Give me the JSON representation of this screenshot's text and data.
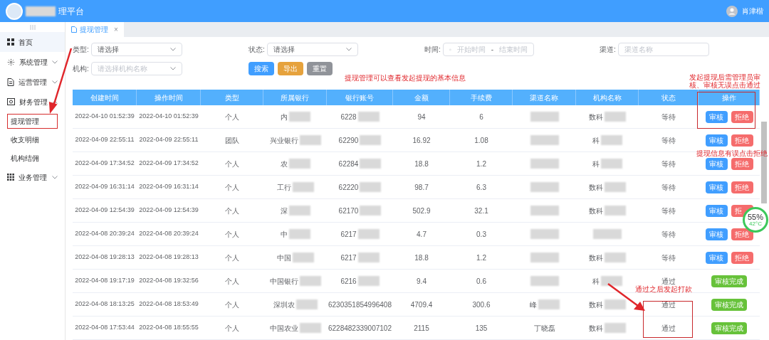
{
  "header": {
    "title": "理平台",
    "user": "肖津楷"
  },
  "sidebar": {
    "items": [
      {
        "label": "首页",
        "selected": true
      },
      {
        "label": "系统管理",
        "expanded": false
      },
      {
        "label": "运营管理",
        "expanded": false
      },
      {
        "label": "财务管理",
        "expanded": true,
        "children": [
          {
            "label": "提现管理",
            "selected": true
          },
          {
            "label": "收支明细",
            "selected": false
          },
          {
            "label": "机构结佣",
            "selected": false
          }
        ]
      },
      {
        "label": "业务管理",
        "expanded": false
      }
    ]
  },
  "tabs": [
    {
      "label": "提现管理",
      "selected": true,
      "close": "×"
    }
  ],
  "filters": [
    {
      "label": "类型:",
      "kind": "select",
      "value": "请选择"
    },
    {
      "label": "状态:",
      "kind": "select",
      "value": "请选择"
    },
    {
      "label": "时间:",
      "kind": "range",
      "start": "开始时间",
      "sep": "-",
      "end": "结束时间"
    },
    {
      "label": "渠道:",
      "kind": "text",
      "placeholder": "渠道名称"
    },
    {
      "label": "机构:",
      "kind": "select",
      "placeholder": "请选择机构名称"
    }
  ],
  "buttons": [
    {
      "label": "搜索",
      "kind": "primary"
    },
    {
      "label": "导出",
      "kind": "warning"
    },
    {
      "label": "重置",
      "kind": "neutral"
    }
  ],
  "table": {
    "columns": [
      "创建时间",
      "操作时间",
      "类型",
      "所属银行",
      "银行账号",
      "金额",
      "手续费",
      "渠道名称",
      "机构名称",
      "状态",
      "操作"
    ],
    "rows": [
      {
        "created": "2022-04-10 01:52:39",
        "updated": "2022-04-10 01:52:39",
        "type": "个人",
        "bank": {
          "text": "内",
          "redacted": true
        },
        "account": {
          "text": "6228",
          "redacted": true
        },
        "amount": "94",
        "fee": "6",
        "channel": {
          "redacted": true
        },
        "org": {
          "text": "数科",
          "redacted": true
        },
        "status": "等待",
        "actions": [
          {
            "label": "审核",
            "kind": "approve"
          },
          {
            "label": "拒绝",
            "kind": "reject"
          }
        ]
      },
      {
        "created": "2022-04-09 22:55:11",
        "updated": "2022-04-09 22:55:11",
        "type": "团队",
        "bank": {
          "text": "兴业银行",
          "redacted": true
        },
        "account": {
          "text": "62290",
          "redacted": true
        },
        "amount": "16.92",
        "fee": "1.08",
        "channel": {
          "redacted": true
        },
        "org": {
          "text": "科",
          "redacted": true
        },
        "status": "等待",
        "actions": [
          {
            "label": "审核",
            "kind": "approve"
          },
          {
            "label": "拒绝",
            "kind": "reject"
          }
        ]
      },
      {
        "created": "2022-04-09 17:34:52",
        "updated": "2022-04-09 17:34:52",
        "type": "个人",
        "bank": {
          "text": "农",
          "redacted": true
        },
        "account": {
          "text": "62284",
          "redacted": true
        },
        "amount": "18.8",
        "fee": "1.2",
        "channel": {
          "redacted": true
        },
        "org": {
          "text": "科",
          "redacted": true
        },
        "status": "等待",
        "actions": [
          {
            "label": "审核",
            "kind": "approve"
          },
          {
            "label": "拒绝",
            "kind": "reject"
          }
        ]
      },
      {
        "created": "2022-04-09 16:31:14",
        "updated": "2022-04-09 16:31:14",
        "type": "个人",
        "bank": {
          "text": "工行",
          "redacted": true
        },
        "account": {
          "text": "62220",
          "redacted": true
        },
        "amount": "98.7",
        "fee": "6.3",
        "channel": {
          "redacted": true
        },
        "org": {
          "text": "数科",
          "redacted": true
        },
        "status": "等待",
        "actions": [
          {
            "label": "审核",
            "kind": "approve"
          },
          {
            "label": "拒绝",
            "kind": "reject"
          }
        ]
      },
      {
        "created": "2022-04-09 12:54:39",
        "updated": "2022-04-09 12:54:39",
        "type": "个人",
        "bank": {
          "text": "深",
          "redacted": true
        },
        "account": {
          "text": "62170",
          "redacted": true
        },
        "amount": "502.9",
        "fee": "32.1",
        "channel": {
          "redacted": true
        },
        "org": {
          "text": "数科",
          "redacted": true
        },
        "status": "等待",
        "actions": [
          {
            "label": "审核",
            "kind": "approve"
          },
          {
            "label": "拒",
            "kind": "reject"
          }
        ]
      },
      {
        "created": "2022-04-08 20:39:24",
        "updated": "2022-04-08 20:39:24",
        "type": "个人",
        "bank": {
          "text": "中",
          "redacted": true
        },
        "account": {
          "text": "6217",
          "redacted": true
        },
        "amount": "4.7",
        "fee": "0.3",
        "channel": {
          "redacted": true
        },
        "org": {
          "redacted": true
        },
        "status": "等待",
        "actions": [
          {
            "label": "审核",
            "kind": "approve"
          },
          {
            "label": "拒绝",
            "kind": "reject"
          }
        ]
      },
      {
        "created": "2022-04-08 19:28:13",
        "updated": "2022-04-08 19:28:13",
        "type": "个人",
        "bank": {
          "text": "中国",
          "redacted": true
        },
        "account": {
          "text": "6217",
          "redacted": true
        },
        "amount": "18.8",
        "fee": "1.2",
        "channel": {
          "redacted": true
        },
        "org": {
          "text": "数科",
          "redacted": true
        },
        "status": "等待",
        "actions": [
          {
            "label": "审核",
            "kind": "approve"
          },
          {
            "label": "拒绝",
            "kind": "reject"
          }
        ]
      },
      {
        "created": "2022-04-08 19:17:19",
        "updated": "2022-04-08 19:32:56",
        "type": "个人",
        "bank": {
          "text": "中国银行",
          "redacted": true
        },
        "account": {
          "text": "6216",
          "redacted": true
        },
        "amount": "9.4",
        "fee": "0.6",
        "channel": {
          "redacted": true
        },
        "org": {
          "text": "科",
          "redacted": true
        },
        "status": "通过",
        "actions": [
          {
            "label": "审核完成",
            "kind": "done"
          }
        ]
      },
      {
        "created": "2022-04-08 18:13:25",
        "updated": "2022-04-08 18:53:49",
        "type": "个人",
        "bank": {
          "text": "深圳农",
          "redacted": true
        },
        "account": {
          "text": "6230351854996408",
          "redacted": false
        },
        "amount": "4709.4",
        "fee": "300.6",
        "channel": {
          "text": "峰",
          "redacted": true
        },
        "org": {
          "text": "数科",
          "redacted": true
        },
        "status": "通过",
        "actions": [
          {
            "label": "审核完成",
            "kind": "done"
          }
        ]
      },
      {
        "created": "2022-04-08 17:53:44",
        "updated": "2022-04-08 18:55:55",
        "type": "个人",
        "bank": {
          "text": "中国农业",
          "redacted": true
        },
        "account": {
          "text": "6228482339007102",
          "redacted": false
        },
        "amount": "2115",
        "fee": "135",
        "channel": {
          "text": "丁晓磊",
          "redacted": false
        },
        "org": {
          "text": "数科",
          "redacted": true
        },
        "status": "通过",
        "actions": [
          {
            "label": "审核完成",
            "kind": "done"
          }
        ]
      }
    ]
  },
  "annotations": [
    {
      "text": "提现管理可以查看发起提现的基本信息"
    },
    {
      "text": "发起提现后需管理员审核、审核无误点击通过"
    },
    {
      "text": "提现信息有误点击拒绝"
    },
    {
      "text": "通过之后发起打款"
    }
  ],
  "monitor_widget": {
    "value": "55%",
    "temp": "42°C"
  }
}
